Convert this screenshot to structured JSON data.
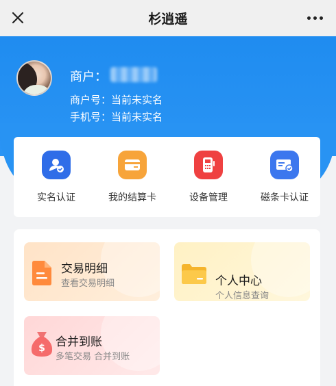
{
  "navbar": {
    "title": "杉逍遥"
  },
  "merchant": {
    "label": "商户：",
    "id_key": "商户号：",
    "id_value": "当前未实名",
    "phone_key": "手机号：",
    "phone_value": "当前未实名"
  },
  "quick_actions": [
    {
      "label": "实名认证",
      "icon": "user-verify-icon",
      "color": "#2f6de8"
    },
    {
      "label": "我的结算卡",
      "icon": "card-icon",
      "color": "#f7a43a"
    },
    {
      "label": "设备管理",
      "icon": "pos-device-icon",
      "color": "#ef4141"
    },
    {
      "label": "磁条卡认证",
      "icon": "card-verify-icon",
      "color": "#3c77ee"
    }
  ],
  "tiles": [
    {
      "title": "交易明细",
      "subtitle": "查看交易明细",
      "icon": "document-icon"
    },
    {
      "title": "个人中心",
      "subtitle": "个人信息查询",
      "icon": "folder-icon"
    },
    {
      "title": "合并到账",
      "subtitle": "多笔交易 合并到账",
      "icon": "money-bag-icon"
    }
  ]
}
